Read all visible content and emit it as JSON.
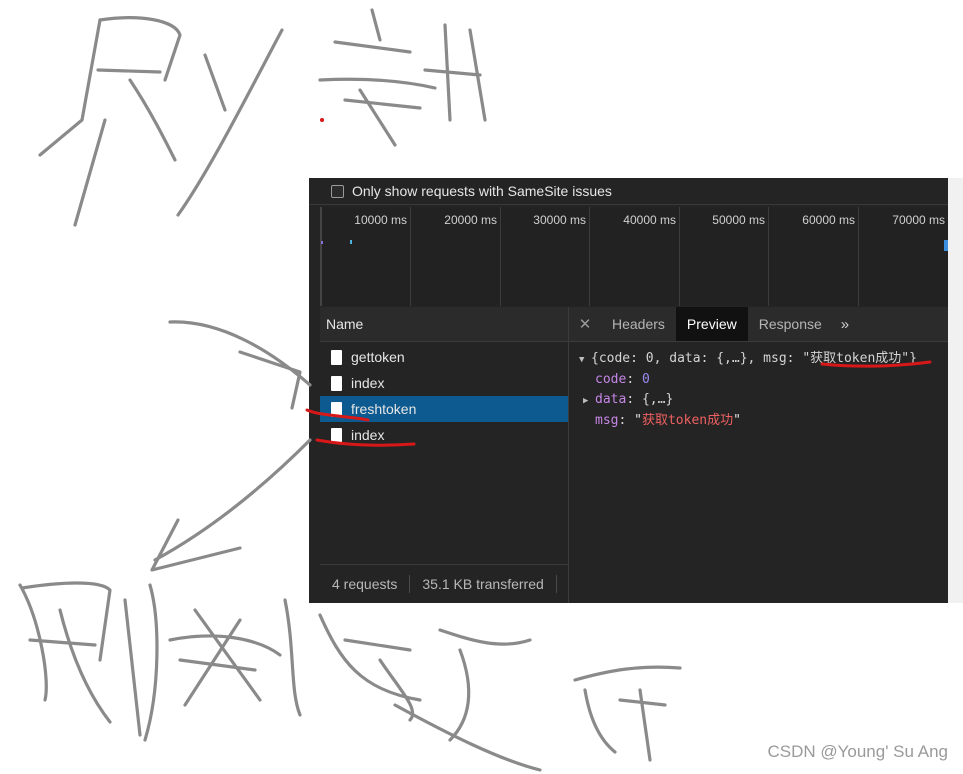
{
  "filter": {
    "label": "Only show requests with SameSite issues"
  },
  "timeline": {
    "ticks": [
      "10000 ms",
      "20000 ms",
      "30000 ms",
      "40000 ms",
      "50000 ms",
      "60000 ms",
      "70000 ms"
    ]
  },
  "network": {
    "column_header": "Name",
    "requests": [
      {
        "name": "gettoken",
        "selected": false
      },
      {
        "name": "index",
        "selected": false
      },
      {
        "name": "freshtoken",
        "selected": true
      },
      {
        "name": "index",
        "selected": false
      }
    ],
    "status": {
      "requests": "4 requests",
      "transferred": "35.1 KB transferred"
    }
  },
  "detail": {
    "close_icon": "close-icon",
    "tabs": [
      "Headers",
      "Preview",
      "Response"
    ],
    "active_tab": "Preview",
    "more_icon": "double-chevron-right-icon",
    "preview": {
      "summary_open": "{code: 0, data: {,…}, msg: \"",
      "summary_msg": "获取token成功",
      "summary_close": "\"}",
      "code_key": "code",
      "code_value": "0",
      "data_key": "data",
      "data_value": "{,…}",
      "msg_key": "msg",
      "msg_value": "获取token成功"
    }
  },
  "watermark": "CSDN @Young' Su Ang",
  "colors": {
    "selection": "#0d5a90",
    "ink": "#8a8a8a",
    "underline": "#d81818"
  }
}
